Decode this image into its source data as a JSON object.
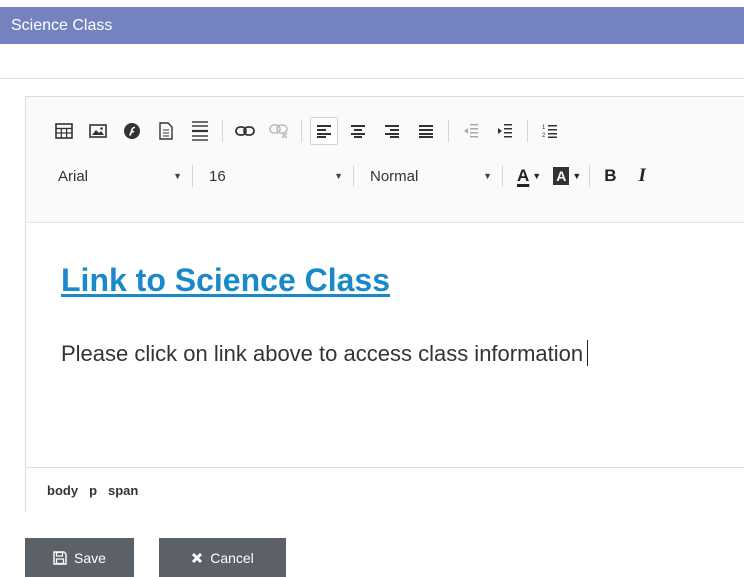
{
  "window": {
    "title": "Science Class"
  },
  "toolbar": {
    "icons": [
      "table-icon",
      "image-icon",
      "flash-icon",
      "document-icon",
      "horizontal-rule-icon",
      "link-icon",
      "unlink-icon",
      "align-left-icon",
      "align-center-icon",
      "align-right-icon",
      "align-justify-icon",
      "outdent-icon",
      "indent-icon",
      "ordered-list-icon"
    ],
    "font_family": "Arial",
    "font_size": "16",
    "block_format": "Normal",
    "text_color_letter": "A",
    "bg_color_letter": "A",
    "bold_label": "B",
    "italic_label": "I"
  },
  "content": {
    "link_text": "Link to Science Class",
    "paragraph": "Please click on link above to access class information"
  },
  "statusbar": {
    "path": [
      "body",
      "p",
      "span"
    ]
  },
  "actions": {
    "save_label": "Save",
    "cancel_label": "Cancel"
  },
  "colors": {
    "title_bg": "#7483c0",
    "link": "#1a89c9",
    "button_bg": "#5c6167"
  }
}
